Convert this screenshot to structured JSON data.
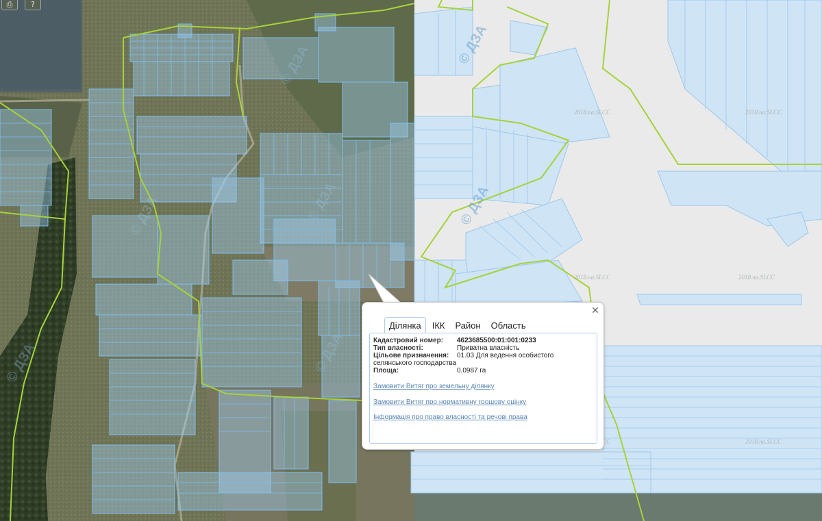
{
  "map": {
    "watermark": "© ДЗА",
    "attribution": "2018.na.SLCC",
    "tool_icons": [
      "print-icon",
      "help-icon"
    ],
    "tool_glyphs": [
      "⎙",
      "?"
    ],
    "colors": {
      "parcel_fill": "#a9d2f0",
      "parcel_stroke": "#5aa6e0",
      "boundary": "#a6d23a",
      "base_map": "#eaeaea"
    }
  },
  "popup": {
    "close_glyph": "✕",
    "tabs": [
      {
        "label": "Ділянка",
        "active": true
      },
      {
        "label": "ІКК",
        "active": false
      },
      {
        "label": "Район",
        "active": false
      },
      {
        "label": "Область",
        "active": false
      }
    ],
    "fields": {
      "cadastral_label": "Кадастровий номер:",
      "cadastral_value": "4623685500:01:001:0233",
      "ownership_label": "Тип власності:",
      "ownership_value": "Приватна власність",
      "purpose_label": "Цільове призначення:",
      "purpose_value_line1": "01.03 Для ведення особистого",
      "purpose_value_line2": "селянського господарства",
      "area_label": "Площа:",
      "area_value": "0.0987 га"
    },
    "links": [
      "Замовити Витяг про земельну ділянку",
      "Замовити Витяг про нормативну грошову оцінку",
      "Інформація про право власності та речові права"
    ]
  }
}
